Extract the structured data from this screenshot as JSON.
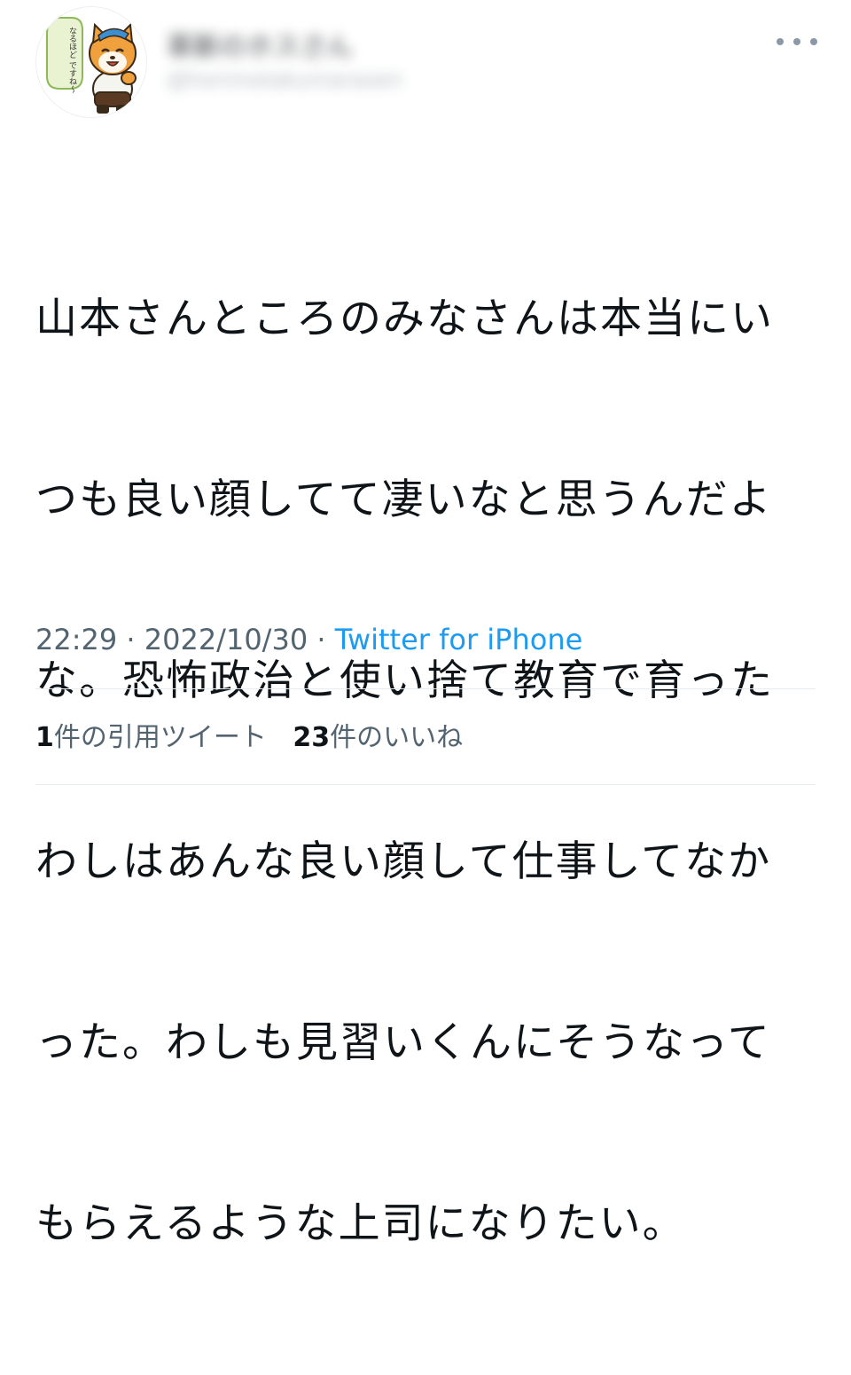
{
  "user": {
    "display_name": "革新のホスさん",
    "handle": "@horimotakumarasen"
  },
  "avatar": {
    "caption": "なるほど ですね〜"
  },
  "tweet": {
    "text": "山本さんところのみなさんは本当にいつも良い顔してて凄いなと思うんだよな。恐怖政治と使い捨て教育で育ったわしはあんな良い顔して仕事してなかった。わしも見習いくんにそうなってもらえるような上司になりたい。",
    "lines": [
      "山本さんところのみなさんは本当にい",
      "つも良い顔してて凄いなと思うんだよ",
      "な。恐怖政治と使い捨て教育で育った",
      "わしはあんな良い顔して仕事してなか",
      "った。わしも見習いくんにそうなって",
      "もらえるような上司になりたい。"
    ]
  },
  "meta": {
    "time": "22:29",
    "separator": " · ",
    "date": "2022/10/30",
    "source": "Twitter for iPhone"
  },
  "stats": {
    "quote_count": "1",
    "quote_label": "件の引用ツイート",
    "like_count": "23",
    "like_label": "件のいいね"
  },
  "colors": {
    "text": "#0f1419",
    "secondary": "#536471",
    "link": "#1d9bf0",
    "divider": "#e6ecf0"
  }
}
